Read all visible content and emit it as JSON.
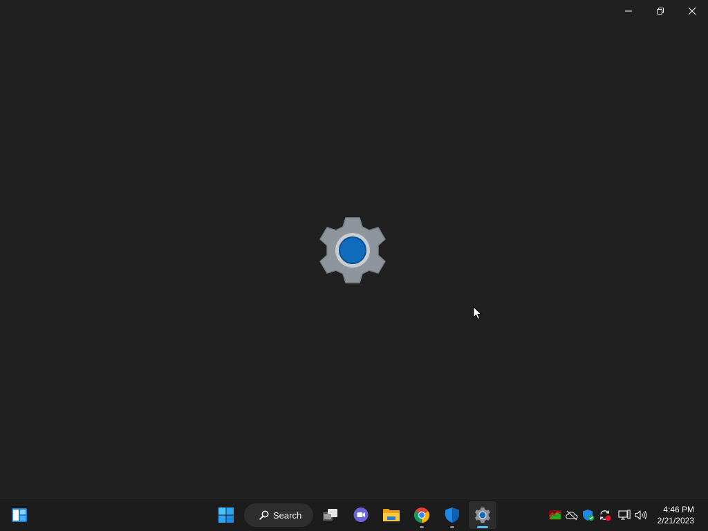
{
  "window": {
    "controls": {
      "minimize_icon": "minimize-icon",
      "restore_icon": "restore-icon",
      "close_icon": "close-icon"
    },
    "splash_icon": "settings-gear-icon"
  },
  "taskbar": {
    "widgets_icon": "widgets-icon",
    "start_icon": "windows-start-icon",
    "search": {
      "label": "Search",
      "icon": "search-icon"
    },
    "apps": [
      {
        "name": "task-view",
        "icon": "task-view-icon",
        "running": false
      },
      {
        "name": "teams-chat",
        "icon": "teams-chat-icon",
        "running": false
      },
      {
        "name": "file-explorer",
        "icon": "folder-icon",
        "running": false
      },
      {
        "name": "chrome",
        "icon": "chrome-icon",
        "running": true
      },
      {
        "name": "defender",
        "icon": "shield-icon",
        "running": true
      },
      {
        "name": "settings",
        "icon": "gear-icon",
        "running": true,
        "active": true
      }
    ],
    "tray": [
      {
        "icon": "gpu-monitor-icon"
      },
      {
        "icon": "cloud-off-icon"
      },
      {
        "icon": "security-shield-icon"
      },
      {
        "icon": "sync-alert-icon"
      },
      {
        "icon": "network-icon"
      },
      {
        "icon": "volume-icon"
      }
    ],
    "clock": {
      "time": "4:46 PM",
      "date": "2/21/2023"
    }
  },
  "colors": {
    "background": "#202020",
    "taskbar": "#1c1c1c",
    "accent": "#4cc2ff",
    "gear_gray": "#8f959c",
    "gear_blue": "#0f6cbd"
  }
}
